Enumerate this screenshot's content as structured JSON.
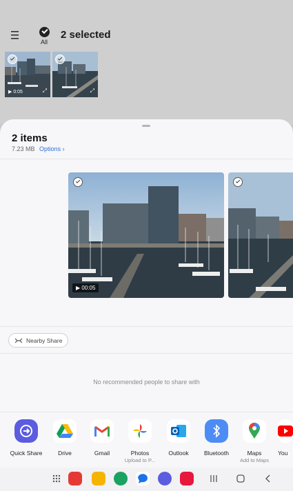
{
  "header": {
    "selected_title": "2 selected",
    "all_label": "All"
  },
  "gallery": {
    "thumbnails": [
      {
        "duration": "0:05",
        "selected": true
      },
      {
        "duration": "",
        "selected": true
      }
    ]
  },
  "sheet": {
    "title": "2 items",
    "size": "7.23 MB",
    "options_label": "Options",
    "previews": [
      {
        "duration": "00:05",
        "selected": true
      },
      {
        "duration": "",
        "selected": true
      }
    ],
    "nearby_share_label": "Nearby Share",
    "no_people_text": "No recommended people to share with",
    "apps": [
      {
        "name": "Quick Share",
        "sub": "",
        "icon": "quick-share-icon"
      },
      {
        "name": "Drive",
        "sub": "",
        "icon": "drive-icon"
      },
      {
        "name": "Gmail",
        "sub": "",
        "icon": "gmail-icon"
      },
      {
        "name": "Photos",
        "sub": "Upload to P...",
        "icon": "photos-icon"
      },
      {
        "name": "Outlook",
        "sub": "",
        "icon": "outlook-icon"
      },
      {
        "name": "Bluetooth",
        "sub": "",
        "icon": "bluetooth-icon"
      },
      {
        "name": "Maps",
        "sub": "Add to Maps",
        "icon": "maps-icon"
      },
      {
        "name": "You",
        "sub": "",
        "icon": "youtube-icon"
      }
    ]
  },
  "colors": {
    "accent": "#2a6fd6",
    "quick_share": "#5b5ce0",
    "bluetooth": "#4e8cf5",
    "youtube": "#ff0000"
  }
}
